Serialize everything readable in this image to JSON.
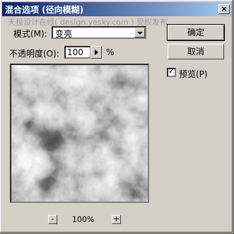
{
  "window": {
    "title": "混合选项 (径向模糊)",
    "watermark": "天极设计在线( design.yesky.com ) 受权发布"
  },
  "mode": {
    "label": "模式(M):",
    "value": "变亮"
  },
  "opacity": {
    "label": "不透明度(O):",
    "value": "100",
    "unit": "%"
  },
  "buttons": {
    "ok": "确定",
    "cancel": "取消"
  },
  "preview_checkbox": {
    "label": "预览(P)",
    "checked": true
  },
  "zoom": {
    "minus": "-",
    "plus": "+",
    "level": "100%"
  },
  "icons": {
    "close": "close-icon",
    "dropdown": "chevron-down-icon",
    "slider": "triangle-right-icon"
  }
}
